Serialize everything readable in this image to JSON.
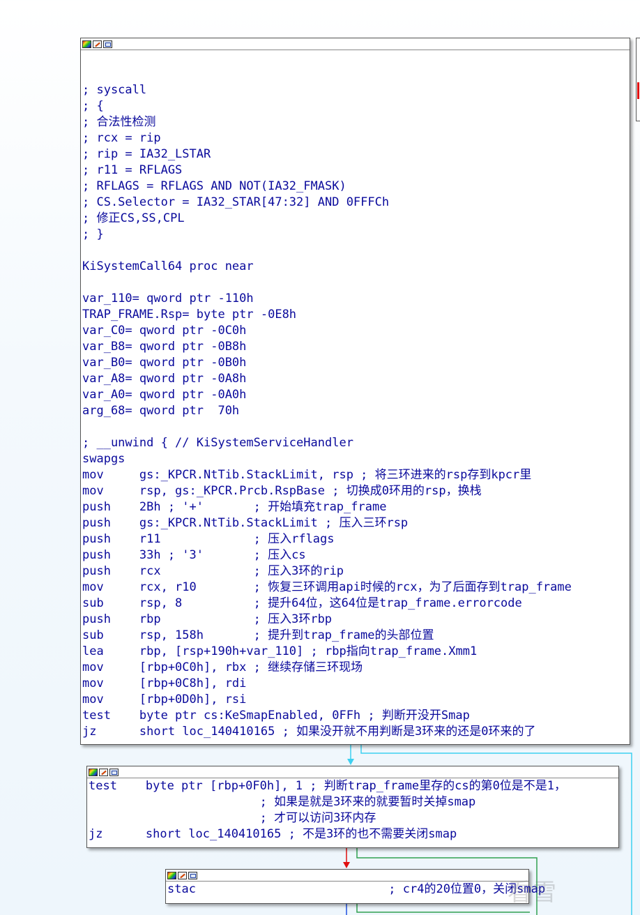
{
  "colors": {
    "comment": "#0a0a9c",
    "var": "#0a7a0a",
    "number": "#0a7a0a",
    "string": "#808080",
    "edge_cyan": "#3dd0f0",
    "edge_green": "#30a050",
    "edge_red": "#e01010",
    "edge_blue": "#2050e0"
  },
  "title_icons": [
    "color-palette-icon",
    "edit-pencil-icon",
    "graph-view-icon"
  ],
  "block1": {
    "lines": [
      {
        "t": ""
      },
      {
        "t": ""
      },
      {
        "t": "; syscall"
      },
      {
        "t": "; {"
      },
      {
        "t": "; 合法性检测"
      },
      {
        "t": "; rcx = rip"
      },
      {
        "t": "; rip = IA32_LSTAR"
      },
      {
        "t": "; r11 = RFLAGS"
      },
      {
        "t": "; RFLAGS = RFLAGS AND NOT(IA32_FMASK)"
      },
      {
        "t": "; CS.Selector = IA32_STAR[47:32] AND 0FFFCh"
      },
      {
        "t": "; 修正CS,SS,CPL"
      },
      {
        "t": "; }"
      },
      {
        "t": ""
      },
      {
        "t": "KiSystemCall64 proc near"
      },
      {
        "t": ""
      },
      {
        "t": "var_110= qword ptr -110h"
      },
      {
        "t": "TRAP_FRAME.Rsp= byte ptr -0E8h"
      },
      {
        "t": "var_C0= qword ptr -0C0h"
      },
      {
        "t": "var_B8= qword ptr -0B8h"
      },
      {
        "t": "var_B0= qword ptr -0B0h"
      },
      {
        "t": "var_A8= qword ptr -0A8h"
      },
      {
        "t": "var_A0= qword ptr -0A0h"
      },
      {
        "t": "arg_68= qword ptr  70h"
      },
      {
        "t": ""
      },
      {
        "t": "; __unwind { // KiSystemServiceHandler"
      },
      {
        "t": "swapgs"
      },
      {
        "t": "mov     gs:_KPCR.NtTib.StackLimit, rsp ; 将三环进来的rsp存到kpcr里"
      },
      {
        "t": "mov     rsp, gs:_KPCR.Prcb.RspBase ; 切换成0环用的rsp，换栈"
      },
      {
        "t": "push    2Bh ; '+'       ; 开始填充trap_frame"
      },
      {
        "t": "push    gs:_KPCR.NtTib.StackLimit ; 压入三环rsp"
      },
      {
        "t": "push    r11             ; 压入rflags"
      },
      {
        "t": "push    33h ; '3'       ; 压入cs"
      },
      {
        "t": "push    rcx             ; 压入3环的rip"
      },
      {
        "t": "mov     rcx, r10        ; 恢复三环调用api时候的rcx，为了后面存到trap_frame"
      },
      {
        "t": "sub     rsp, 8          ; 提升64位，这64位是trap_frame.errorcode"
      },
      {
        "t": "push    rbp             ; 压入3环rbp"
      },
      {
        "t": "sub     rsp, 158h       ; 提升到trap_frame的头部位置"
      },
      {
        "t": "lea     rbp, [rsp+190h+var_110] ; rbp指向trap_frame.Xmm1"
      },
      {
        "t": "mov     [rbp+0C0h], rbx ; 继续存储三环现场"
      },
      {
        "t": "mov     [rbp+0C8h], rdi"
      },
      {
        "t": "mov     [rbp+0D0h], rsi"
      },
      {
        "t": "test    byte ptr cs:KeSmapEnabled, 0FFh ; 判断开没开Smap"
      },
      {
        "t": "jz      short loc_140410165 ; 如果没开就不用判断是3环来的还是0环来的了"
      }
    ]
  },
  "block2": {
    "lines": [
      {
        "t": "test    byte ptr [rbp+0F0h], 1 ; 判断trap_frame里存的cs的第0位是不是1，"
      },
      {
        "t": "                        ; 如果是就是3环来的就要暂时关掉smap"
      },
      {
        "t": "                        ; 才可以访问3环内存"
      },
      {
        "t": "jz      short loc_140410165 ; 不是3环的也不需要关闭smap"
      }
    ]
  },
  "block3": {
    "lines": [
      {
        "t": "stac                           ; cr4的20位置0，关闭smap"
      }
    ]
  },
  "watermark": "看雪"
}
